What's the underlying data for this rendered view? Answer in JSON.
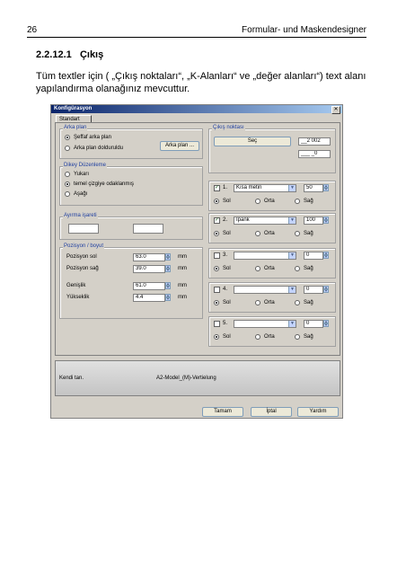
{
  "header": {
    "page_number": "26",
    "doc_title": "Formular- und Maskendesigner"
  },
  "section": {
    "number": "2.2.12.1",
    "title": "Çıkış"
  },
  "body": {
    "text": "Tüm textler için ( „Çıkış noktaları“, „K-Alanları“ ve „değer alanları“) text alanı yapılandırma olanağınız mevcuttur."
  },
  "dialog": {
    "title": "Konfigürasyon",
    "tab": "Standart",
    "close_glyph": "✕",
    "background": {
      "label": "Arka plan",
      "opt1": "Şeffaf arka plan",
      "opt2": "Arka plan dolduruldu",
      "button": "Arka plan ..."
    },
    "vertical": {
      "label": "Dikey Düzenleme",
      "opt1": "Yukarı",
      "opt2": "temel çizgiye odaklanmış",
      "opt3": "Aşağı"
    },
    "separator": {
      "label": "Ayırma işareti"
    },
    "position": {
      "label": "Pozisyon / boyut",
      "left_label": "Pozisyon sol",
      "left_value": "63.0",
      "right_label": "Pozisyon sağ",
      "right_value": "39.0",
      "width_label": "Genişlik",
      "width_value": "61.0",
      "height_label": "Yükseklik",
      "height_value": "4.4",
      "unit": "mm"
    },
    "output_points": {
      "label": "Çıkış noktası",
      "select_button": "Seç",
      "value1": "__2 002",
      "value2": "___ _0"
    },
    "rows": [
      {
        "num": "1.",
        "checked": true,
        "field": "Kısa metin",
        "size": "50"
      },
      {
        "num": "2.",
        "checked": true,
        "field": "İpank",
        "size": "100"
      },
      {
        "num": "3.",
        "checked": false,
        "field": "",
        "size": "0"
      },
      {
        "num": "4.",
        "checked": false,
        "field": "",
        "size": "0"
      },
      {
        "num": "5.",
        "checked": false,
        "field": "",
        "size": "0"
      }
    ],
    "align": {
      "left": "Sol",
      "center": "Orta",
      "right": "Sağ"
    },
    "status": {
      "left": "Kendi tan.",
      "center": "A2-Model_(M)-Vertielung"
    },
    "buttons": {
      "ok": "Tamam",
      "cancel": "İptal",
      "help": "Yardım"
    }
  }
}
